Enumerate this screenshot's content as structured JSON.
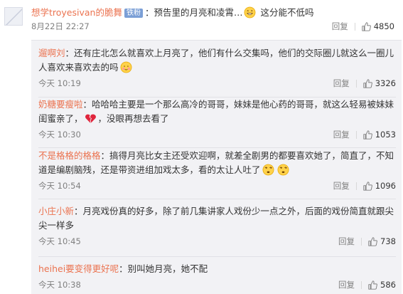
{
  "main_comment": {
    "user": "想学troyesivan的脆舞",
    "badge": "铁粉",
    "text": "：预告里的月亮和凌霄…",
    "text_after": " 这分能不低吗",
    "time": "8月22日 22:27",
    "reply_label": "回复",
    "likes": "4850"
  },
  "replies": [
    {
      "user": "遛啊刘",
      "text": "：还有庄北怎么就喜欢上月亮了，他们有什么交集吗，他们的交际圈儿就这么一圈儿人喜欢来喜欢去的吗",
      "time": "今天 10:19",
      "reply_label": "回复",
      "likes": "3326"
    },
    {
      "user": "奶糖要瘦啦",
      "text": "：哈哈哈主要是一个那么高冷的哥哥，妹妹是他心药的哥哥，就这么轻易被妹妹闺蜜亲了，",
      "text_after": "，没眼再想去看了",
      "time": "今天 10:30",
      "reply_label": "回复",
      "likes": "1053"
    },
    {
      "user": "不是格格的格格",
      "text": "：搞得月亮比女主还受欢迎啊，就差全剧男的都要喜欢她了，简直了，不知道是编剧脑残，还是带资进组加戏太多，看的太让人吐了",
      "time": "今天 10:54",
      "reply_label": "回复",
      "likes": "1096"
    },
    {
      "user": "小庄小新",
      "text": "：月亮戏份真的好多，除了前几集讲家人戏份少一点之外，后面的戏份简直就跟尖尖一样多",
      "time": "今天 10:45",
      "reply_label": "回复",
      "likes": "738"
    },
    {
      "user": "heihei要变得更好呢",
      "text": "：别叫她月亮，她不配",
      "time": "今天 10:38",
      "reply_label": "回复",
      "likes": "586"
    }
  ],
  "icons": {
    "like": "thumbs-up-icon",
    "avatar": "avatar-placeholder",
    "emoji_laugh": "grin-emoji-icon",
    "emoji_shy": "shy-emoji-icon",
    "emoji_broken_heart": "broken-heart-icon",
    "emoji_dizzy": "dizzy-emoji-icon"
  },
  "colors": {
    "username": "#eb7350",
    "reply_background": "#f2f2f5",
    "meta_text": "#808080"
  }
}
